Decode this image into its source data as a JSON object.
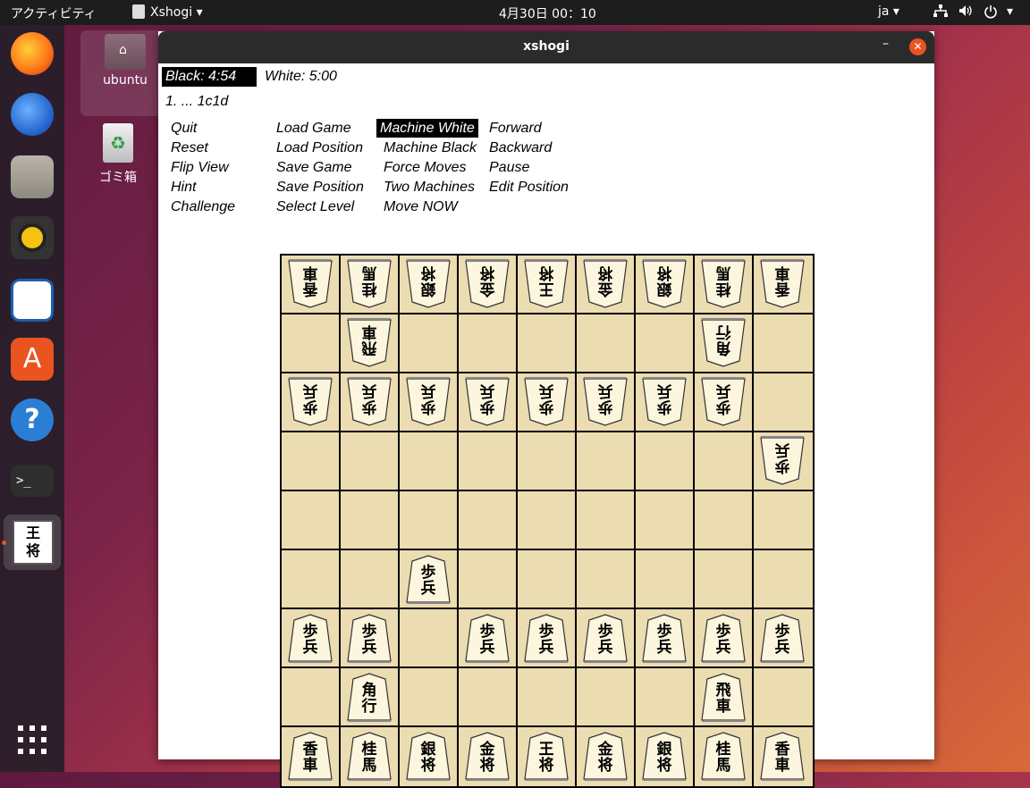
{
  "topbar": {
    "activities": "アクティビティ",
    "app_name": "Xshogi",
    "clock": "4月30日  00：10",
    "lang": "ja"
  },
  "desktop": {
    "home_label": "ubuntu",
    "trash_label": "ゴミ箱"
  },
  "window": {
    "title": "xshogi",
    "black_clock": "Black:  4:54",
    "white_clock": "White:  5:00",
    "move": "1. ... 1c1d",
    "menu": {
      "col1": [
        "Quit",
        "Reset",
        "Flip View",
        "Hint",
        "Challenge"
      ],
      "col2": [
        "Load Game",
        "Load Position",
        "Save Game",
        "Save Position",
        "Select Level"
      ],
      "col3": [
        "Machine White",
        "Machine Black",
        "Force Moves",
        "Two Machines",
        "Move NOW"
      ],
      "col4": [
        "Forward",
        "Backward",
        "Pause",
        "Edit Position"
      ]
    }
  },
  "board": {
    "rows": [
      [
        "香車w",
        "桂馬w",
        "銀将w",
        "金将w",
        "王将w",
        "金将w",
        "銀将w",
        "桂馬w",
        "香車w"
      ],
      [
        "",
        "飛車w",
        "",
        "",
        "",
        "",
        "",
        "角行w",
        ""
      ],
      [
        "歩兵w",
        "歩兵w",
        "歩兵w",
        "歩兵w",
        "歩兵w",
        "歩兵w",
        "歩兵w",
        "歩兵w",
        ""
      ],
      [
        "",
        "",
        "",
        "",
        "",
        "",
        "",
        "",
        "歩兵w"
      ],
      [
        "",
        "",
        "",
        "",
        "",
        "",
        "",
        "",
        ""
      ],
      [
        "",
        "",
        "歩兵b",
        "",
        "",
        "",
        "",
        "",
        ""
      ],
      [
        "歩兵b",
        "歩兵b",
        "",
        "歩兵b",
        "歩兵b",
        "歩兵b",
        "歩兵b",
        "歩兵b",
        "歩兵b"
      ],
      [
        "",
        "角行b",
        "",
        "",
        "",
        "",
        "",
        "飛車b",
        ""
      ],
      [
        "香車b",
        "桂馬b",
        "銀将b",
        "金将b",
        "王将b",
        "金将b",
        "銀将b",
        "桂馬b",
        "香車b"
      ]
    ]
  },
  "colors": {
    "board": "#ecdcb2",
    "piece": "#fbf6dd",
    "accent": "#e95420"
  }
}
